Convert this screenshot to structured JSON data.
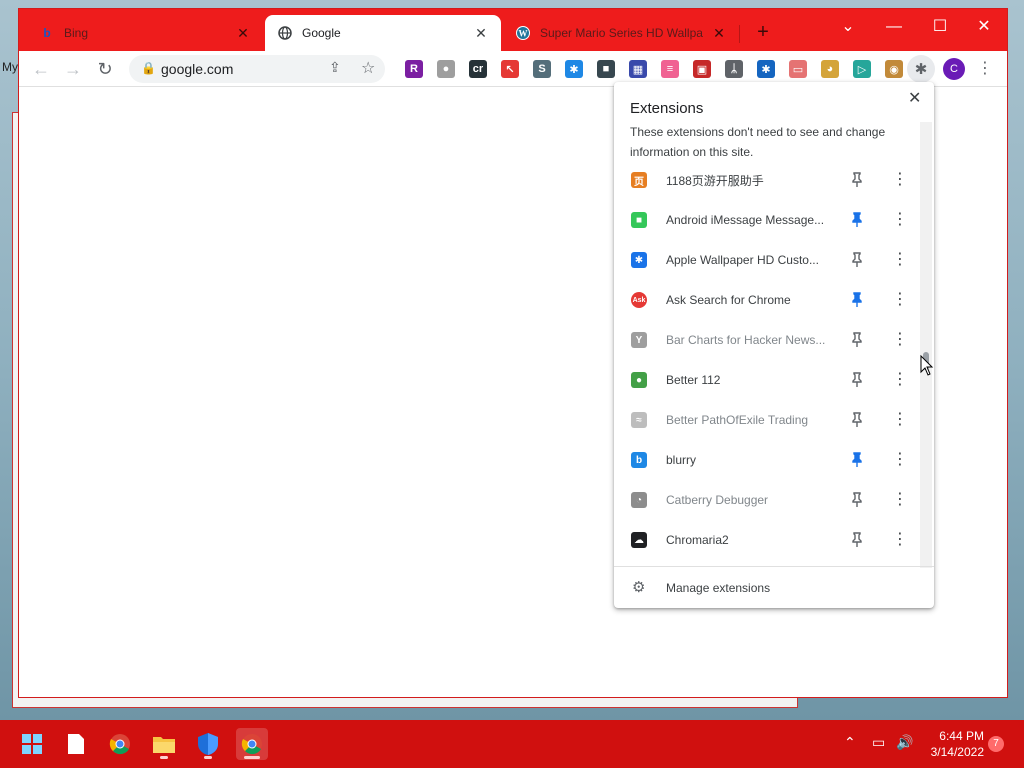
{
  "desktop": {
    "label": "My"
  },
  "behind_window": {
    "status": ""
  },
  "tabs": [
    {
      "title": "Bing",
      "favicon": "bing-icon",
      "active": false
    },
    {
      "title": "Google",
      "favicon": "globe-icon",
      "active": true
    },
    {
      "title": "Super Mario Series HD Wallpa",
      "favicon": "wordpress-icon",
      "active": false
    }
  ],
  "window_controls": {
    "tab_search": "⌄",
    "minimize": "—",
    "maximize": "☐",
    "close": "✕"
  },
  "toolbar": {
    "back": "←",
    "forward": "→",
    "reload": "↻",
    "url": "google.com",
    "profile_initial": "C"
  },
  "toolbar_extensions": [
    {
      "name": "r-extension-icon",
      "glyph": "R",
      "color": "#7b1fa2"
    },
    {
      "name": "elephant-extension-icon",
      "glyph": "●",
      "color": "#9e9e9e"
    },
    {
      "name": "cr-extension-icon",
      "glyph": "cr",
      "color": "#263238"
    },
    {
      "name": "cursor-extension-icon",
      "glyph": "↖",
      "color": "#e53935"
    },
    {
      "name": "s-extension-icon",
      "glyph": "S",
      "color": "#546e7a"
    },
    {
      "name": "puzzle-extension-icon",
      "glyph": "✱",
      "color": "#1e88e5"
    },
    {
      "name": "dark-extension-icon",
      "glyph": "■",
      "color": "#37474f"
    },
    {
      "name": "calendar-extension-icon",
      "glyph": "▦",
      "color": "#3949ab"
    },
    {
      "name": "flag-extension-icon",
      "glyph": "≡",
      "color": "#f06292"
    },
    {
      "name": "image-extension-icon",
      "glyph": "▣",
      "color": "#c62828"
    },
    {
      "name": "feather-extension-icon",
      "glyph": "ᛦ",
      "color": "#5f6368"
    },
    {
      "name": "puzzle-extension-icon-2",
      "glyph": "✱",
      "color": "#1565c0"
    },
    {
      "name": "screen-extension-icon",
      "glyph": "▭",
      "color": "#e57373"
    },
    {
      "name": "doge-extension-icon",
      "glyph": "◕",
      "color": "#d4a43a"
    },
    {
      "name": "play-extension-icon",
      "glyph": "▷",
      "color": "#26a69a"
    },
    {
      "name": "monkey-extension-icon",
      "glyph": "◉",
      "color": "#c28a3a"
    }
  ],
  "popup": {
    "title": "Extensions",
    "description": "These extensions don't need to see and change information on this site.",
    "close": "✕",
    "manage_label": "Manage extensions",
    "extensions": [
      {
        "name": "1188页游开服助手",
        "icon": "game-icon",
        "glyph": "页",
        "color": "#e67e22",
        "pinned": false,
        "dim": false
      },
      {
        "name": "Android iMessage Message...",
        "icon": "message-icon",
        "glyph": "■",
        "color": "#34c759",
        "pinned": true,
        "dim": false
      },
      {
        "name": "Apple Wallpaper HD Custo...",
        "icon": "puzzle-icon",
        "glyph": "✱",
        "color": "#1a73e8",
        "pinned": false,
        "dim": false
      },
      {
        "name": "Ask Search for Chrome",
        "icon": "ask-icon",
        "glyph": "Ask",
        "color": "#e53935",
        "pinned": true,
        "dim": false
      },
      {
        "name": "Bar Charts for Hacker News...",
        "icon": "hacker-news-icon",
        "glyph": "Y",
        "color": "#9e9e9e",
        "pinned": false,
        "dim": true
      },
      {
        "name": "Better 112",
        "icon": "better-112-icon",
        "glyph": "●",
        "color": "#43a047",
        "pinned": false,
        "dim": false
      },
      {
        "name": "Better PathOfExile Trading",
        "icon": "poe-icon",
        "glyph": "≈",
        "color": "#bdbdbd",
        "pinned": false,
        "dim": true
      },
      {
        "name": "blurry",
        "icon": "blurry-icon",
        "glyph": "b",
        "color": "#1e88e5",
        "pinned": true,
        "dim": false
      },
      {
        "name": "Catberry Debugger",
        "icon": "cat-icon",
        "glyph": "◔",
        "color": "#8d8d8d",
        "pinned": false,
        "dim": true
      },
      {
        "name": "Chromaria2",
        "icon": "cloud-icon",
        "glyph": "☁",
        "color": "#202124",
        "pinned": false,
        "dim": false
      }
    ]
  },
  "taskbar": {
    "items": [
      {
        "name": "start-button",
        "glyph": "⊞"
      },
      {
        "name": "notepad-icon",
        "glyph": "▯"
      },
      {
        "name": "chrome-icon",
        "glyph": "◎"
      },
      {
        "name": "file-explorer-icon",
        "glyph": "▬"
      },
      {
        "name": "security-icon",
        "glyph": "⛉"
      },
      {
        "name": "chrome-active-icon",
        "glyph": "◎"
      }
    ],
    "tray": {
      "chevron": "⌃",
      "network": "▭",
      "volume": "🔊"
    },
    "time": "6:44 PM",
    "date": "3/14/2022",
    "notifications": "7"
  },
  "colors": {
    "accent": "#d0100f",
    "tabstrip": "#ee1c1c",
    "pin_active": "#1a73e8",
    "pin_inactive": "#5f6368"
  }
}
